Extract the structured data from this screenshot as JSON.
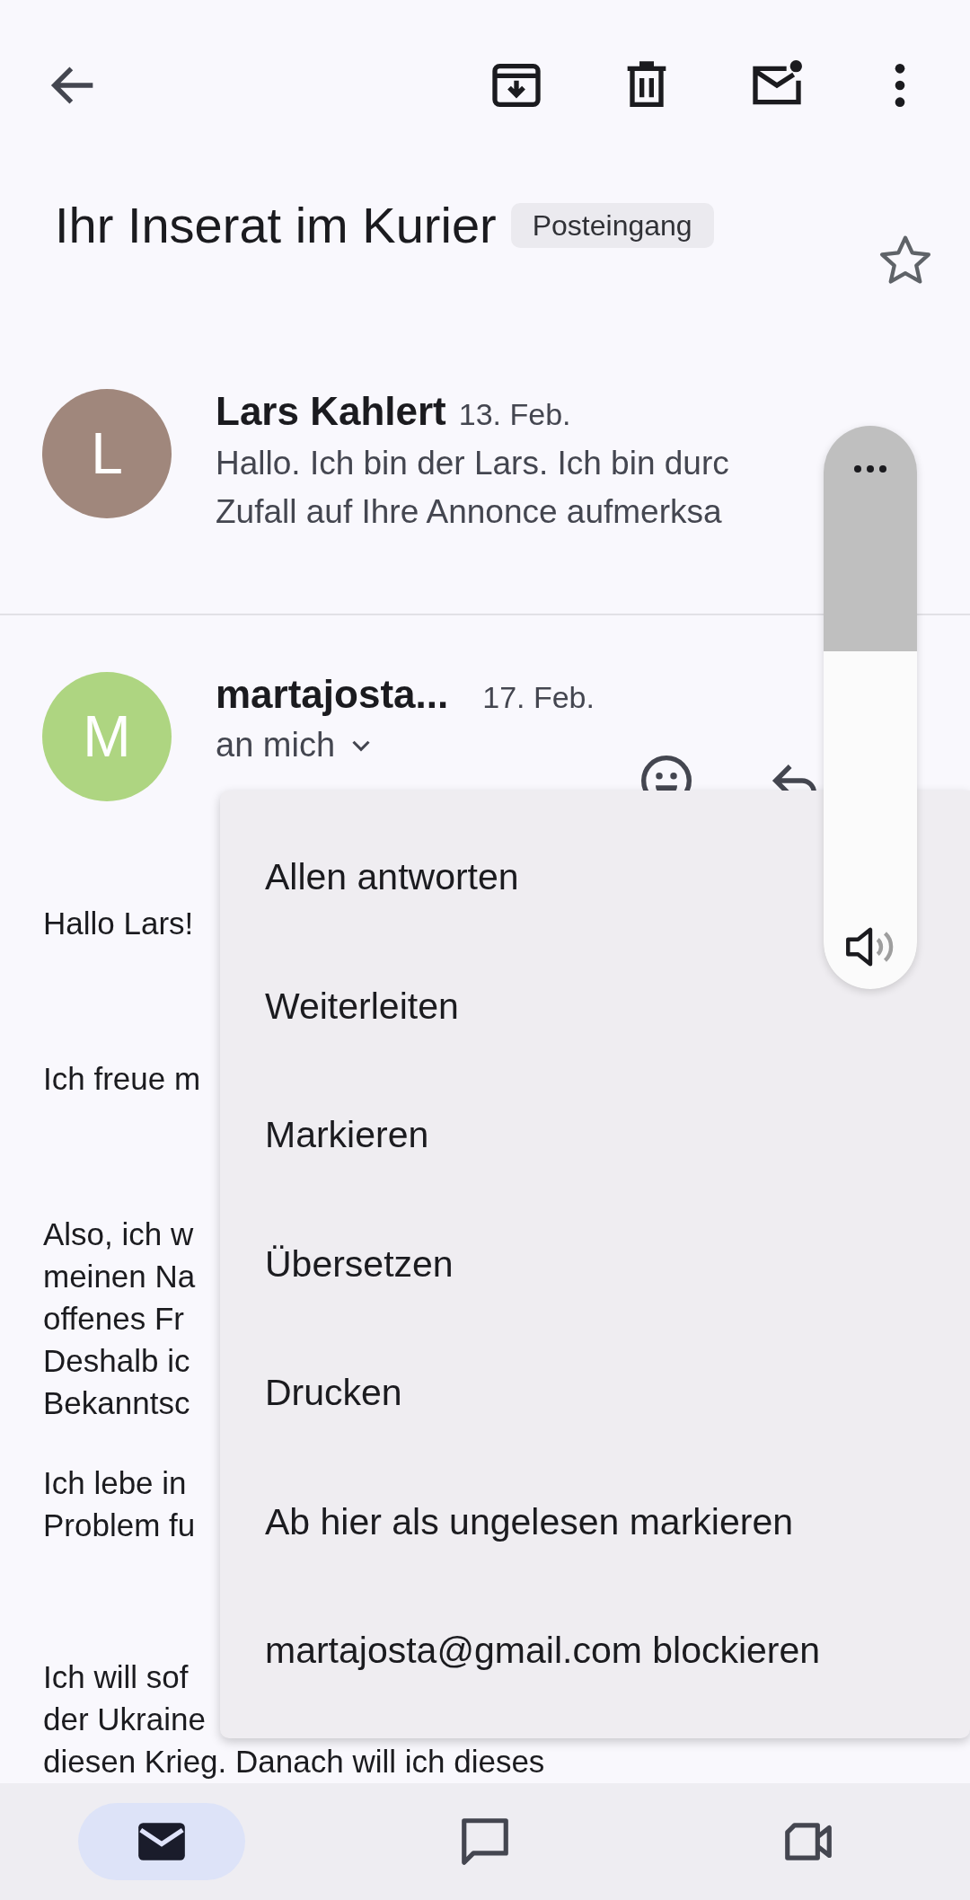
{
  "subject": {
    "title": "Ihr Inserat im Kurier",
    "label": "Posteingang",
    "starred": false
  },
  "messages": [
    {
      "avatar": "L",
      "color": "#a0877c",
      "sender": "Lars Kahlert",
      "date": "13. Feb.",
      "snippet_lines": [
        "Hallo. Ich bin der Lars. Ich bin durc",
        "Zufall auf Ihre Annonce aufmerksa"
      ]
    },
    {
      "avatar": "M",
      "color": "#aed581",
      "sender": "martajosta...",
      "date": "17. Feb.",
      "recipient": "an mich",
      "paragraphs": [
        [
          "Hallo Lars!"
        ],
        [
          "Ich freue m"
        ],
        [
          "Also, ich w",
          "meinen Na",
          "offenes Fr",
          "Deshalb ic",
          "Bekanntsc"
        ],
        [
          "Ich lebe in",
          "Problem fu"
        ],
        [
          "Ich will sof",
          "der Ukraine",
          "diesen Krieg. Danach will ich dieses"
        ]
      ]
    }
  ],
  "menu": {
    "items": [
      "Allen antworten",
      "Weiterleiten",
      "Markieren",
      "Übersetzen",
      "Drucken",
      "Ab hier als ungelesen markieren",
      "martajosta@gmail.com blockieren"
    ]
  },
  "volume": {
    "level": 0.6
  },
  "bottom_nav": [
    {
      "kind": "mail",
      "selected": true
    },
    {
      "kind": "chat",
      "selected": false
    },
    {
      "kind": "video",
      "selected": false
    }
  ]
}
